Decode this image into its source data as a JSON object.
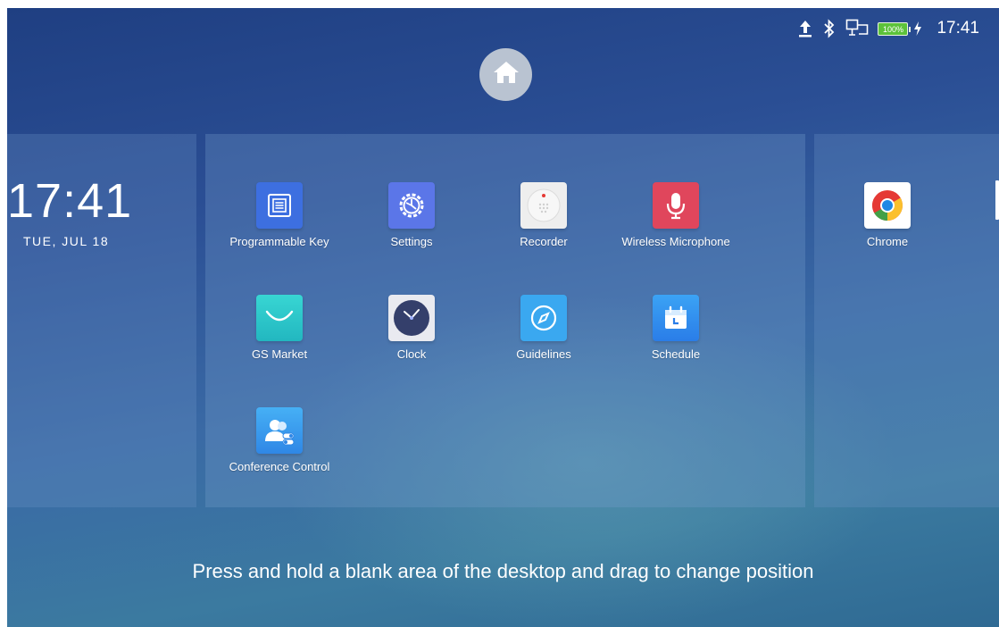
{
  "status_bar": {
    "icons": [
      "upload-icon",
      "bluetooth-icon",
      "network-icon",
      "battery-icon",
      "charging-icon"
    ],
    "battery_label": "100%",
    "time": "17:41"
  },
  "home": {
    "icon": "home-icon"
  },
  "clock_widget": {
    "time": "17:41",
    "date": "TUE, JUL 18"
  },
  "apps": [
    {
      "label": "Programmable Key",
      "icon": "programmable-key-icon",
      "color": "#3d6fe0"
    },
    {
      "label": "Settings",
      "icon": "settings-gear-icon",
      "color": "#5b76e8"
    },
    {
      "label": "Recorder",
      "icon": "recorder-icon",
      "color": "#eeeeee"
    },
    {
      "label": "Wireless Microphone",
      "icon": "microphone-icon",
      "color": "#e0465c"
    },
    {
      "label": "GS Market",
      "icon": "market-bag-icon",
      "color": "#2fc7c9"
    },
    {
      "label": "Clock",
      "icon": "clock-icon",
      "color": "#e9eaf0"
    },
    {
      "label": "Guidelines",
      "icon": "compass-icon",
      "color": "#3aa8f0"
    },
    {
      "label": "Schedule",
      "icon": "calendar-icon",
      "color": "#2f8cf0"
    },
    {
      "label": "Conference Control",
      "icon": "conference-icon",
      "color": "#3a9df0"
    }
  ],
  "right_panel": {
    "apps": [
      {
        "label": "Chrome",
        "icon": "chrome-icon"
      }
    ]
  },
  "hint_text": "Press and hold a blank area of the desktop and drag to change position"
}
